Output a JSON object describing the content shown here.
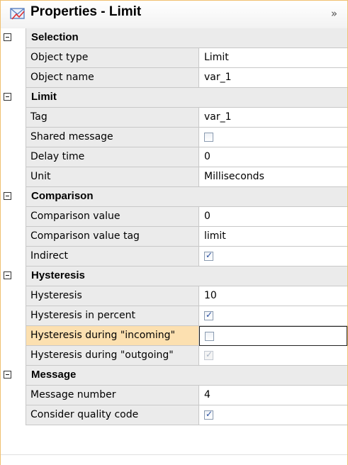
{
  "panel": {
    "title": "Properties - Limit",
    "title_icon": "properties-envelope-icon",
    "collapse_label": "»"
  },
  "colors": {
    "header_bg": "#ebebeb",
    "highlight_bg": "#fce0b0",
    "border": "#c8c8c8",
    "checkbox_check": "#2a50a0"
  },
  "groups": [
    {
      "label": "Selection",
      "rows": [
        {
          "name": "Object type",
          "value": "Limit"
        },
        {
          "name": "Object name",
          "value": "var_1"
        }
      ]
    },
    {
      "label": "Limit",
      "rows": [
        {
          "name": "Tag",
          "value": "var_1"
        },
        {
          "name": "Shared message",
          "checkbox": true,
          "checked": false
        },
        {
          "name": "Delay time",
          "value": "0"
        },
        {
          "name": "Unit",
          "value": "Milliseconds"
        }
      ]
    },
    {
      "label": "Comparison",
      "rows": [
        {
          "name": "Comparison value",
          "value": "0"
        },
        {
          "name": "Comparison value tag",
          "value": "limit"
        },
        {
          "name": "Indirect",
          "checkbox": true,
          "checked": true
        }
      ]
    },
    {
      "label": "Hysteresis",
      "rows": [
        {
          "name": "Hysteresis",
          "value": "10"
        },
        {
          "name": "Hysteresis in percent",
          "checkbox": true,
          "checked": true
        },
        {
          "name": "Hysteresis during \"incoming\"",
          "checkbox": true,
          "checked": false,
          "highlight": true
        },
        {
          "name": "Hysteresis during \"outgoing\"",
          "checkbox": true,
          "checked": true,
          "disabled": true
        }
      ]
    },
    {
      "label": "Message",
      "rows": [
        {
          "name": "Message number",
          "value": "4"
        },
        {
          "name": "Consider quality code",
          "checkbox": true,
          "checked": true
        }
      ]
    }
  ]
}
